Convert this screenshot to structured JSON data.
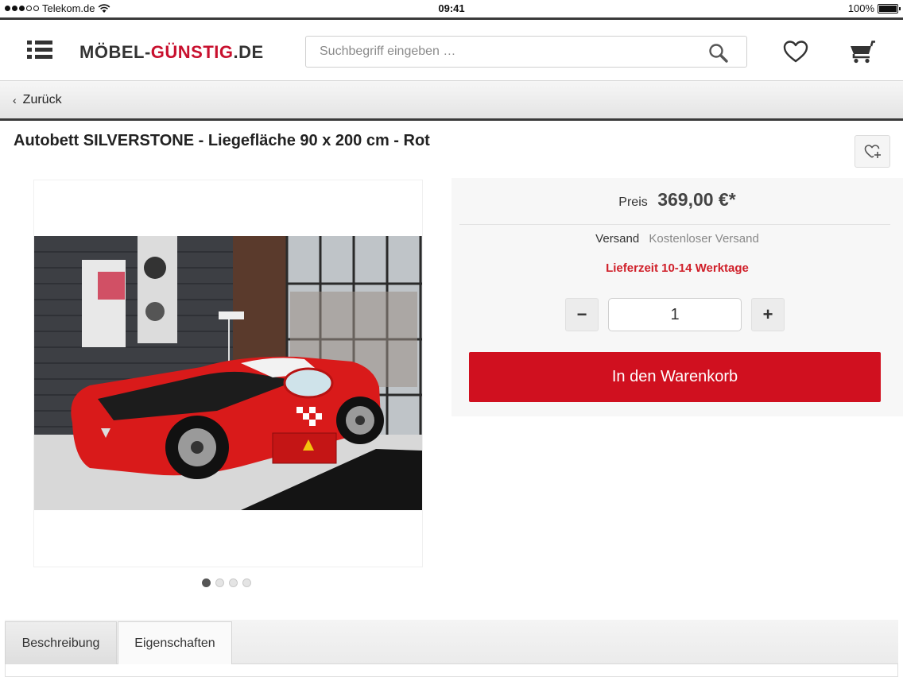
{
  "status_bar": {
    "carrier": "Telekom.de",
    "time": "09:41",
    "battery": "100%"
  },
  "header": {
    "logo": {
      "part1": "MÖBEL-",
      "part2": "GÜNSTIG",
      "part3": ".DE"
    },
    "search_placeholder": "Suchbegriff eingeben …",
    "icons": [
      "menu-icon",
      "search-icon",
      "heart-icon",
      "cart-icon"
    ]
  },
  "nav": {
    "back_label": "Zurück"
  },
  "product": {
    "title": "Autobett SILVERSTONE - Liegefläche 90 x 200 cm - Rot",
    "price_label": "Preis",
    "price": "369,00 €*",
    "shipping_label": "Versand",
    "shipping_value": "Kostenloser Versand",
    "delivery": "Lieferzeit 10-14 Werktage",
    "quantity": "1",
    "minus_label": "−",
    "plus_label": "+",
    "add_to_cart": "In den Warenkorb",
    "gallery_count": 4,
    "gallery_active": 1
  },
  "tabs": [
    {
      "label": "Beschreibung",
      "active": true
    },
    {
      "label": "Eigenschaften",
      "active": false
    }
  ],
  "colors": {
    "brand_red": "#d0101f",
    "accent_text_red": "#d0202a",
    "dark": "#333333"
  }
}
